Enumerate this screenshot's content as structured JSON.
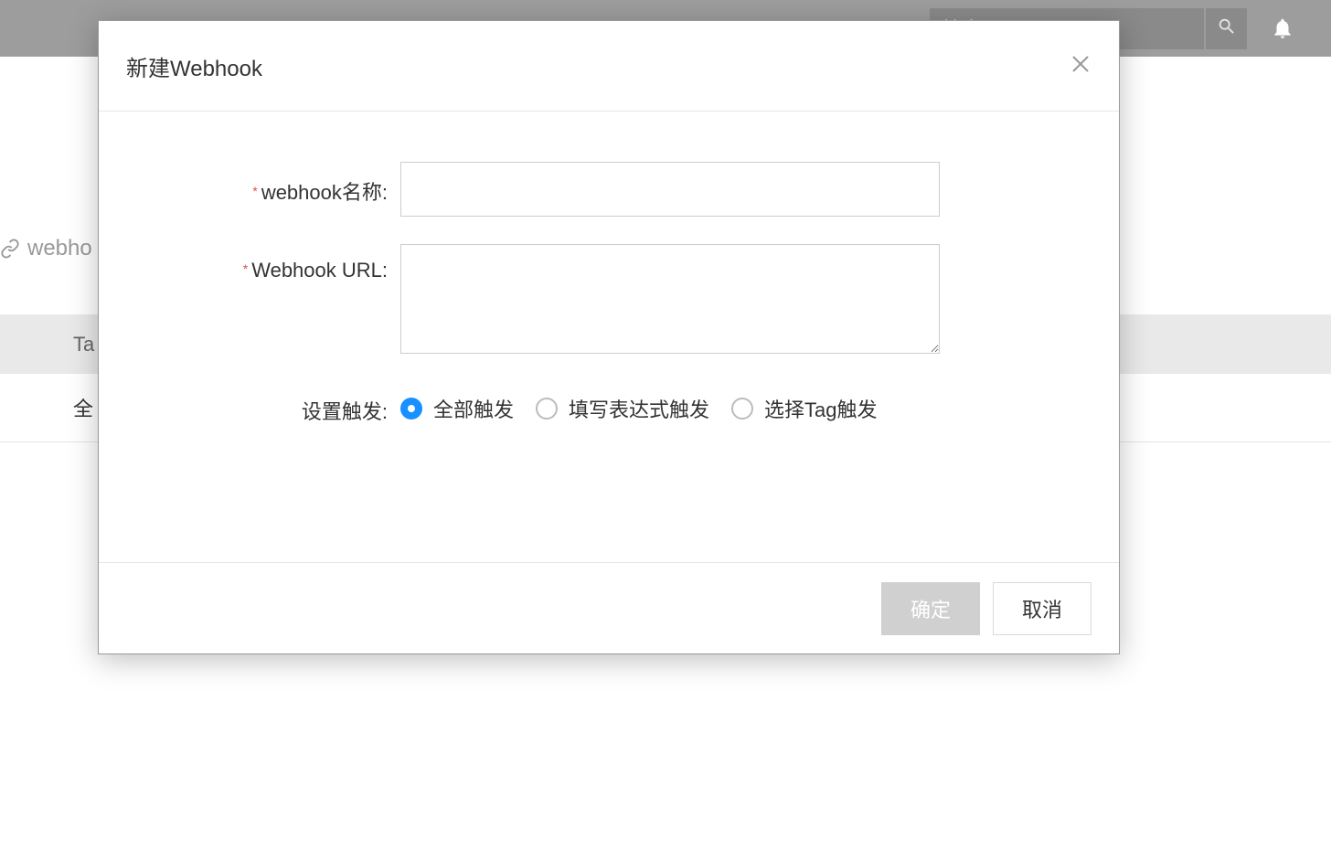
{
  "header": {
    "search_placeholder": "搜索"
  },
  "background": {
    "section_label": "webho",
    "table_header_col1": "Ta",
    "table_row1_col1": "全"
  },
  "modal": {
    "title": "新建Webhook",
    "fields": {
      "name_label": "webhook名称:",
      "name_value": "",
      "url_label": "Webhook URL:",
      "url_value": "",
      "trigger_label": "设置触发:"
    },
    "trigger_options": [
      {
        "label": "全部触发",
        "checked": true
      },
      {
        "label": "填写表达式触发",
        "checked": false
      },
      {
        "label": "选择Tag触发",
        "checked": false
      }
    ],
    "buttons": {
      "confirm": "确定",
      "cancel": "取消"
    }
  }
}
